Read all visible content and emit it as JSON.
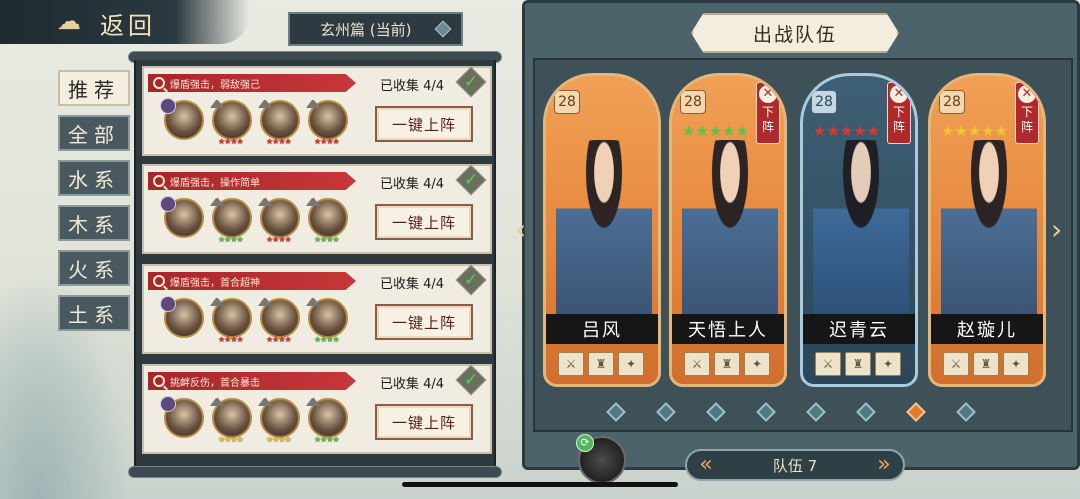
{
  "header": {
    "back_label": "返回"
  },
  "chapter": {
    "label": "玄州篇 (当前)"
  },
  "tabs": [
    {
      "label": "推荐",
      "active": true
    },
    {
      "label": "全部",
      "active": false
    },
    {
      "label": "水系",
      "active": false
    },
    {
      "label": "木系",
      "active": false
    },
    {
      "label": "火系",
      "active": false
    },
    {
      "label": "土系",
      "active": false
    }
  ],
  "lineups": [
    {
      "tag": "爆盾强击，弱敌强己",
      "collected": "已收集 4/4",
      "button": "一键上阵",
      "stars": [
        "★★★★",
        "★★★★",
        "★★★★",
        "★★★★"
      ],
      "star_colors": [
        "r",
        "r",
        "r",
        "r"
      ]
    },
    {
      "tag": "爆盾强击，操作简单",
      "collected": "已收集 4/4",
      "button": "一键上阵",
      "stars": [
        "★★★",
        "★★★★",
        "★★★★",
        "★★★★"
      ],
      "star_colors": [
        "r",
        "g",
        "r",
        "g"
      ]
    },
    {
      "tag": "爆盾强击，首合超神",
      "collected": "已收集 4/4",
      "button": "一键上阵",
      "stars": [
        "★★★",
        "★★★★",
        "★★★★",
        "★★★★"
      ],
      "star_colors": [
        "r",
        "r",
        "r",
        "g"
      ]
    },
    {
      "tag": "挑衅反伤，首合暴击",
      "collected": "已收集 4/4",
      "button": "一键上阵",
      "stars": [
        "★★★",
        "★★★★",
        "★★★★",
        "★★★★"
      ],
      "star_colors": [
        "r",
        "y",
        "y",
        "g"
      ]
    }
  ],
  "team": {
    "title": "出战队伍",
    "heroes": [
      {
        "name": "吕风",
        "level": "28",
        "stars": "",
        "removable": false,
        "style": "orange"
      },
      {
        "name": "天悟上人",
        "level": "28",
        "stars": "★★★★★",
        "star_color": "#52c844",
        "removable": true,
        "remove_label": "下阵",
        "style": "orange"
      },
      {
        "name": "迟青云",
        "level": "28",
        "stars": "★★★★★",
        "star_color": "#e3342f",
        "removable": true,
        "remove_label": "下阵",
        "style": "blue"
      },
      {
        "name": "赵璇儿",
        "level": "28",
        "stars": "★★★★★",
        "star_color": "#f0c730",
        "removable": true,
        "remove_label": "下阵",
        "style": "orange"
      }
    ],
    "switch_label": "队伍 7",
    "page_count": 8,
    "active_page": 7
  },
  "colors": {
    "accent": "#e07a2a",
    "tag_red": "#c8373a",
    "panel_dark": "#2f3a40"
  }
}
